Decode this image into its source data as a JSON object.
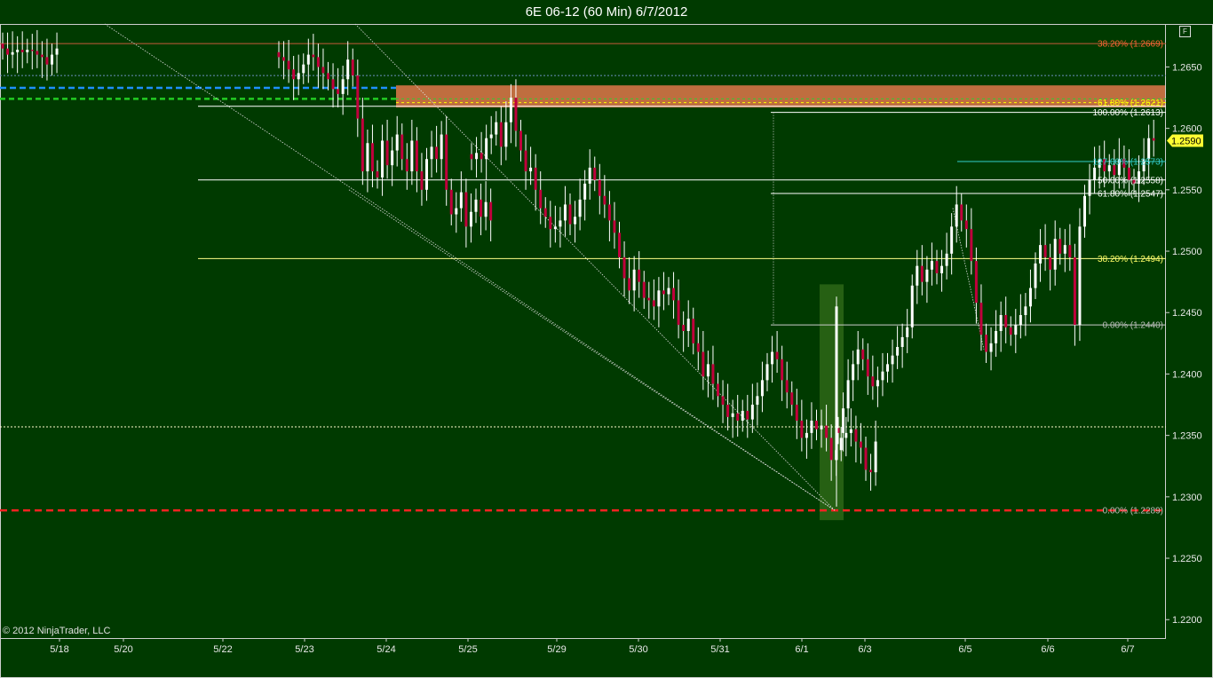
{
  "title": "6E 06-12 (60 Min)  6/7/2012",
  "copyright": "© 2012 NinjaTrader, LLC",
  "panel_button": "F",
  "colors": {
    "background": "#003a00",
    "up_candle": "#ffffff",
    "down_candle": "#c0003c",
    "zone": "#e0784a",
    "last_price_bg": "#ffff33"
  },
  "chart_data": {
    "type": "candlestick",
    "ylim": [
      1.2185,
      1.2685
    ],
    "y_ticks": [
      "1.2200",
      "1.2250",
      "1.2300",
      "1.2350",
      "1.2400",
      "1.2450",
      "1.2500",
      "1.2550",
      "1.2600",
      "1.2650"
    ],
    "x_ticks": [
      "5/18",
      "5/20",
      "5/22",
      "5/23",
      "5/24",
      "5/25",
      "5/29",
      "5/30",
      "5/31",
      "6/1",
      "6/3",
      "6/5",
      "6/6",
      "6/7"
    ],
    "last_price": "1.2590",
    "grid": false,
    "fib_labels": [
      {
        "text": "38.20% (1.2669)",
        "price": 1.2669,
        "color": "#ff6633"
      },
      {
        "text": "61.80% (1.2621)",
        "price": 1.2621,
        "color": "#ffff00"
      },
      {
        "text": "100.00% (1.2613)",
        "price": 1.2613,
        "color": "#ffffff"
      },
      {
        "text": "127.00% (1.2573)",
        "price": 1.2573,
        "color": "#33cccc"
      },
      {
        "text": "50.00% (1.2558)",
        "price": 1.2558,
        "color": "#ffffff"
      },
      {
        "text": "61.80% (1.2547)",
        "price": 1.2547,
        "color": "#ffffff"
      },
      {
        "text": "38.20% (1.2494)",
        "price": 1.2494,
        "color": "#ffff66"
      },
      {
        "text": "0.00% (1.2440)",
        "price": 1.244,
        "color": "#bbbbbb"
      },
      {
        "text": "0.00% (1.2289)",
        "price": 1.2289,
        "color": "#bbbbbb"
      }
    ],
    "price_path": [
      [
        1.2665,
        1.266,
        1.2662,
        1.2664,
        1.2662,
        1.2664,
        1.2663,
        1.266,
        1.2658,
        1.2652,
        1.266,
        1.2665
      ],
      [
        1.2658,
        1.2655,
        1.2648,
        1.264,
        1.2645,
        1.2652,
        1.266,
        1.2658,
        1.265,
        1.2645,
        1.264,
        1.2632,
        1.2628,
        1.264,
        1.2656,
        1.2643,
        1.2608,
        1.2565,
        1.2588,
        1.2565,
        1.256,
        1.259,
        1.257,
        1.2582,
        1.2595,
        1.2575,
        1.2565,
        1.259,
        1.2565,
        1.255,
        1.2575,
        1.2585,
        1.2575,
        1.2595,
        1.255,
        1.253,
        1.2535,
        1.2548,
        1.252,
        1.2532,
        1.2542,
        1.2528,
        1.254,
        1.2525
      ],
      [
        1.2575,
        1.258,
        1.2575,
        1.2592,
        1.2595,
        1.2605,
        1.2585,
        1.2605,
        1.2625,
        1.2598,
        1.2582,
        1.2565,
        1.2568,
        1.255,
        1.2535,
        1.2528,
        1.2518,
        1.252,
        1.2525,
        1.2538,
        1.2522,
        1.2528,
        1.2542,
        1.2555,
        1.2568,
        1.2558,
        1.2545,
        1.2538,
        1.2525,
        1.2515,
        1.2495,
        1.2478,
        1.2468,
        1.2485,
        1.2475,
        1.2462,
        1.246,
        1.2455,
        1.2468,
        1.2465,
        1.247,
        1.246,
        1.244,
        1.2435,
        1.2445,
        1.2425,
        1.2418,
        1.2398,
        1.2408,
        1.2392,
        1.2382,
        1.2375,
        1.2365,
        1.2368,
        1.2362,
        1.237,
        1.2363,
        1.2375,
        1.2382,
        1.2395,
        1.2408,
        1.2418,
        1.2412,
        1.2395,
        1.2385,
        1.2375,
        1.2362,
        1.2348,
        1.2352,
        1.2362,
        1.2355,
        1.2358,
        1.2348,
        1.233,
        1.2338,
        1.2348,
        1.2352,
        1.2355,
        1.2345,
        1.234,
        1.2322,
        1.232,
        1.2345
      ],
      [
        1.2352,
        1.2372,
        1.2395,
        1.2408,
        1.242,
        1.2412,
        1.2398,
        1.239,
        1.2395,
        1.2402,
        1.2408,
        1.2415,
        1.2422,
        1.243,
        1.2438,
        1.2472,
        1.2488,
        1.2475,
        1.2485,
        1.2492,
        1.2482,
        1.2488,
        1.2498,
        1.252,
        1.2538,
        1.2525,
        1.2518,
        1.2492,
        1.2458,
        1.2432,
        1.2418,
        1.2425,
        1.2435,
        1.2448,
        1.2438,
        1.2432,
        1.244,
        1.2448,
        1.2455,
        1.247,
        1.249,
        1.2505,
        1.2495,
        1.2485,
        1.251,
        1.2498,
        1.2505,
        1.2495,
        1.244,
        1.252,
        1.2545,
        1.2558,
        1.2568,
        1.2575,
        1.2565,
        1.257,
        1.2562,
        1.2575,
        1.2568,
        1.2558,
        1.2555,
        1.2565,
        1.2575,
        1.2592,
        1.259
      ]
    ]
  }
}
